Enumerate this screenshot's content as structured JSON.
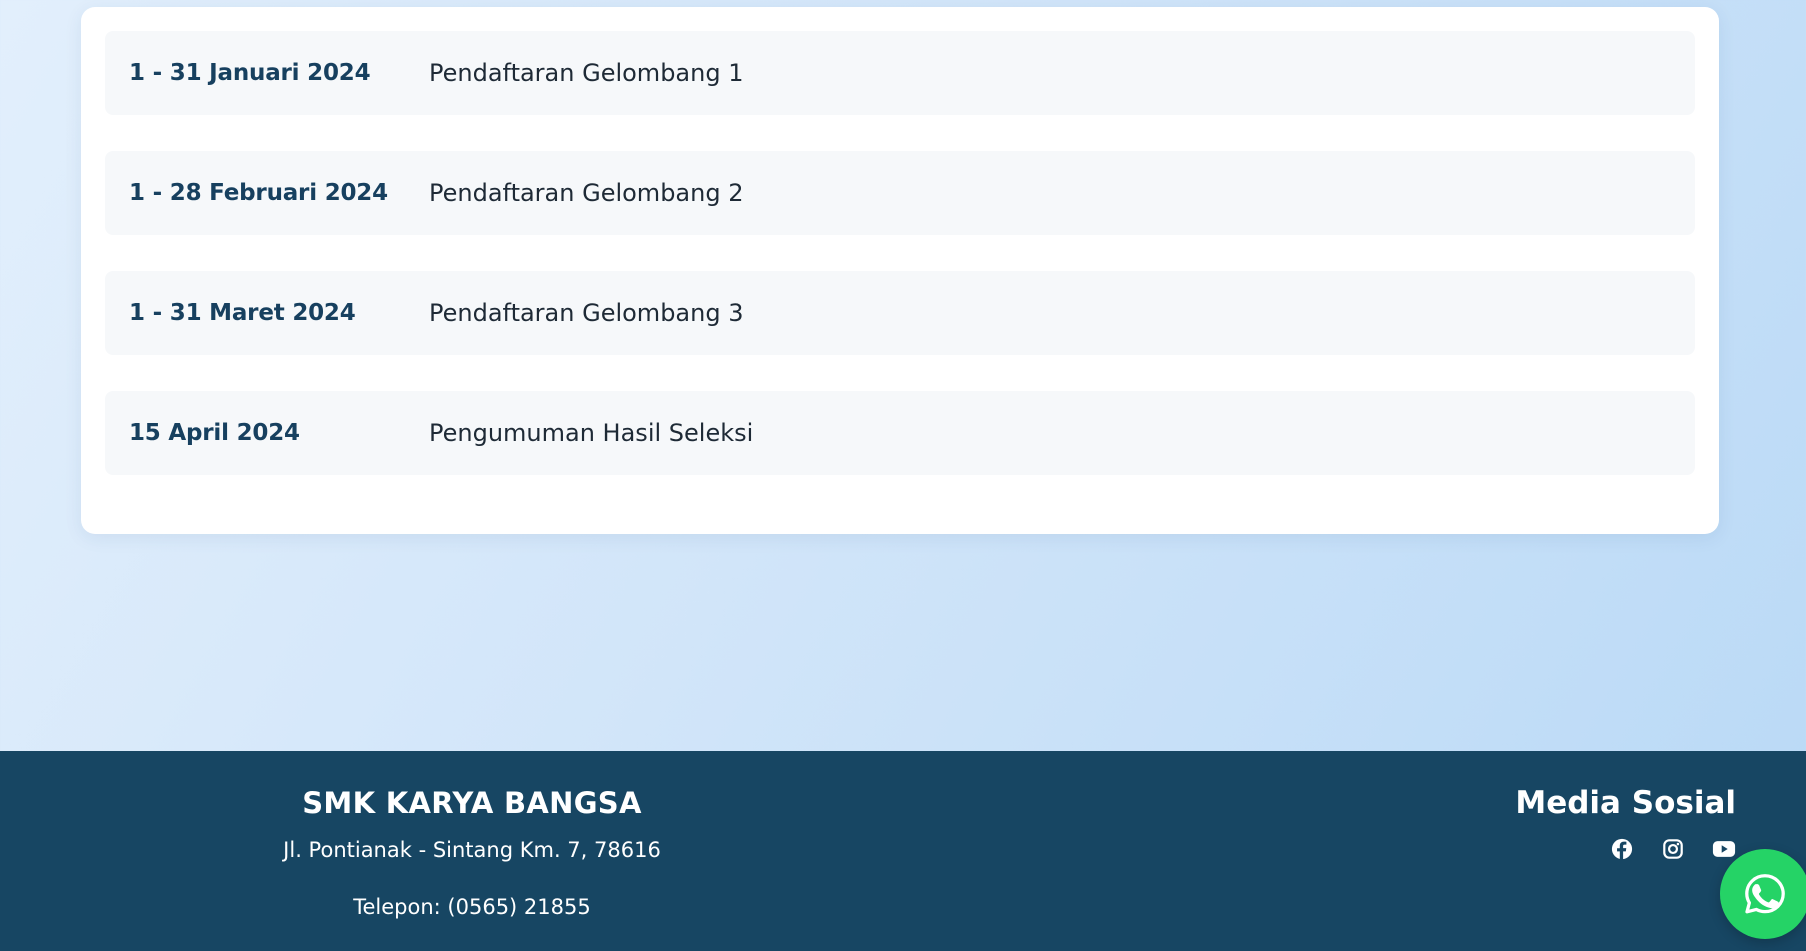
{
  "schedule": {
    "rows": [
      {
        "date": "1 - 31 Januari 2024",
        "event": "Pendaftaran Gelombang 1"
      },
      {
        "date": "1 - 28 Februari 2024",
        "event": "Pendaftaran Gelombang 2"
      },
      {
        "date": "1 - 31 Maret 2024",
        "event": "Pendaftaran Gelombang 3"
      },
      {
        "date": "15 April 2024",
        "event": "Pengumuman Hasil Seleksi"
      }
    ]
  },
  "footer": {
    "school_name": "SMK KARYA BANGSA",
    "address": "Jl. Pontianak - Sintang Km. 7, 78616",
    "phone": "Telepon: (0565) 21855",
    "social_title": "Media Sosial",
    "social_icons": [
      "facebook-icon",
      "instagram-icon",
      "youtube-icon"
    ]
  },
  "floating": {
    "icon": "whatsapp-icon",
    "color": "#25d366"
  },
  "colors": {
    "footer_bg": "#174663",
    "date_text": "#17405f",
    "row_bg": "#f6f8fa"
  }
}
